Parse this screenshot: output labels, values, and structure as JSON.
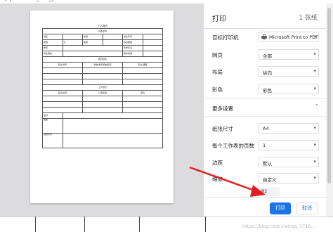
{
  "top_strip_text": "application_nw_promt",
  "preview": {
    "title": "个人简历",
    "section_basic": "基本资料",
    "row1": [
      "姓名",
      "",
      "性别",
      "",
      "出生年月",
      ""
    ],
    "row2": [
      "民族",
      "汉",
      "籍贯",
      "",
      "政治面貌",
      ""
    ],
    "row3": [
      "学历",
      "",
      "",
      "",
      "所学专业",
      ""
    ],
    "row4": [
      "毕业院校",
      "",
      "",
      "",
      "联系电话",
      ""
    ],
    "section_edu": "教育经历",
    "edu_headers": [
      "起止时间",
      "学校/教育机构名称",
      "专业/课程"
    ],
    "section_work": "工作经历",
    "work_headers": [
      "起止时间",
      "公司名称",
      "职位"
    ],
    "row_hobby": "爱好",
    "row_skill": "技能",
    "row_self": "自我评价"
  },
  "panel": {
    "title": "打印",
    "sheet_count": "1 张纸",
    "destination_label": "目标打印机",
    "destination_value": "Microsoft Print to PDF",
    "pages_label": "网页",
    "pages_value": "全部",
    "layout_label": "布局",
    "layout_value": "纵向",
    "color_label": "彩色",
    "color_value": "彩色",
    "more_settings_label": "更多设置",
    "paper_size_label": "纸张尺寸",
    "paper_size_value": "A4",
    "pages_per_sheet_label": "每个工作表的页数",
    "pages_per_sheet_value": "1",
    "margins_label": "边距",
    "margins_value": "默认",
    "scale_label": "缩放",
    "scale_value": "自定义",
    "scale_number": "82",
    "print_button": "打印",
    "cancel_button": "取消"
  },
  "watermark": "https://blog.csdn.net/qq_3716..."
}
